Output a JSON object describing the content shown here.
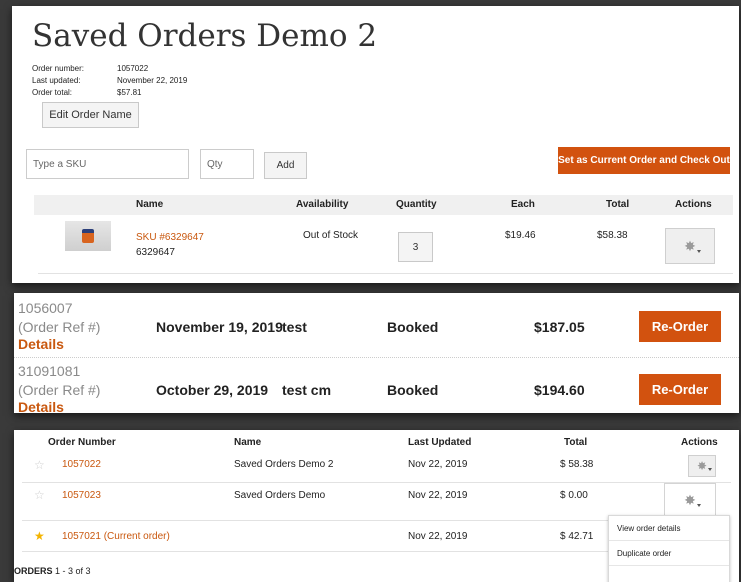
{
  "order": {
    "title": "Saved Orders Demo 2",
    "meta": [
      {
        "label": "Order number:",
        "value": "1057022"
      },
      {
        "label": "Last updated:",
        "value": "November 22, 2019"
      },
      {
        "label": "Order total:",
        "value": "$57.81"
      }
    ],
    "edit_name_label": "Edit Order Name",
    "sku_placeholder": "Type a SKU",
    "qty_placeholder": "Qty",
    "add_label": "Add",
    "checkout_label": "Set as Current Order and Check Out",
    "columns": [
      "Name",
      "Availability",
      "Quantity",
      "Each",
      "Total",
      "Actions"
    ],
    "item": {
      "sku_link": "SKU #6329647",
      "sku": "6329647",
      "availability": "Out of Stock",
      "quantity": "3",
      "each": "$19.46",
      "total": "$58.38"
    }
  },
  "history": [
    {
      "id": "1056007",
      "ref": "(Order Ref #)",
      "details": "Details",
      "date": "November 19, 2019",
      "name": "test",
      "status": "Booked",
      "total": "$187.05",
      "action": "Re-Order"
    },
    {
      "id": "31091081",
      "ref": "(Order Ref #)",
      "details": "Details",
      "date": "October 29, 2019",
      "name": "test cm",
      "status": "Booked",
      "total": "$194.60",
      "action": "Re-Order"
    }
  ],
  "saved": {
    "columns": [
      "Order Number",
      "Name",
      "Last Updated",
      "Total",
      "Actions"
    ],
    "rows": [
      {
        "number": "1057022",
        "name": "Saved Orders Demo 2",
        "updated": "Nov 22, 2019",
        "total": "$ 58.38",
        "starred": false
      },
      {
        "number": "1057023",
        "name": "Saved Orders Demo",
        "updated": "Nov 22, 2019",
        "total": "$ 0.00",
        "starred": false
      },
      {
        "number": "1057021 (Current order)",
        "name": "",
        "updated": "Nov 22, 2019",
        "total": "$ 42.71",
        "starred": true
      }
    ],
    "footer_label": "ORDERS",
    "footer_range": "1 - 3 of 3",
    "menu": [
      "View order details",
      "Duplicate order"
    ]
  },
  "colors": {
    "accent": "#d2520f",
    "link": "#c9580f",
    "star": "#f4b400"
  }
}
